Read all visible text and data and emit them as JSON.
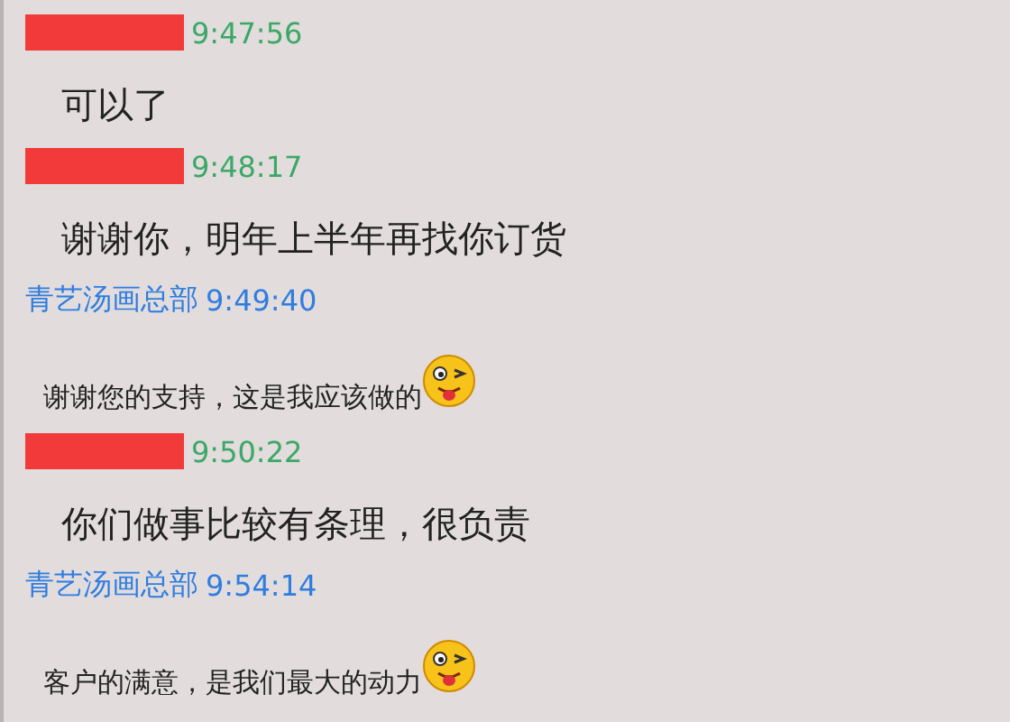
{
  "messages": [
    {
      "kind": "customer",
      "time": "9:47:56",
      "text": "可以了"
    },
    {
      "kind": "customer",
      "time": "9:48:17",
      "text": "谢谢你，明年上半年再找你订货"
    },
    {
      "kind": "shop",
      "sender": "青艺汤画总部",
      "time": "9:49:40",
      "text": "谢谢您的支持，这是我应该做的"
    },
    {
      "kind": "customer",
      "time": "9:50:22",
      "text": "你们做事比较有条理，很负责"
    },
    {
      "kind": "shop",
      "sender": "青艺汤画总部",
      "time": "9:54:14",
      "text": "客户的满意，是我们最大的动力"
    }
  ]
}
